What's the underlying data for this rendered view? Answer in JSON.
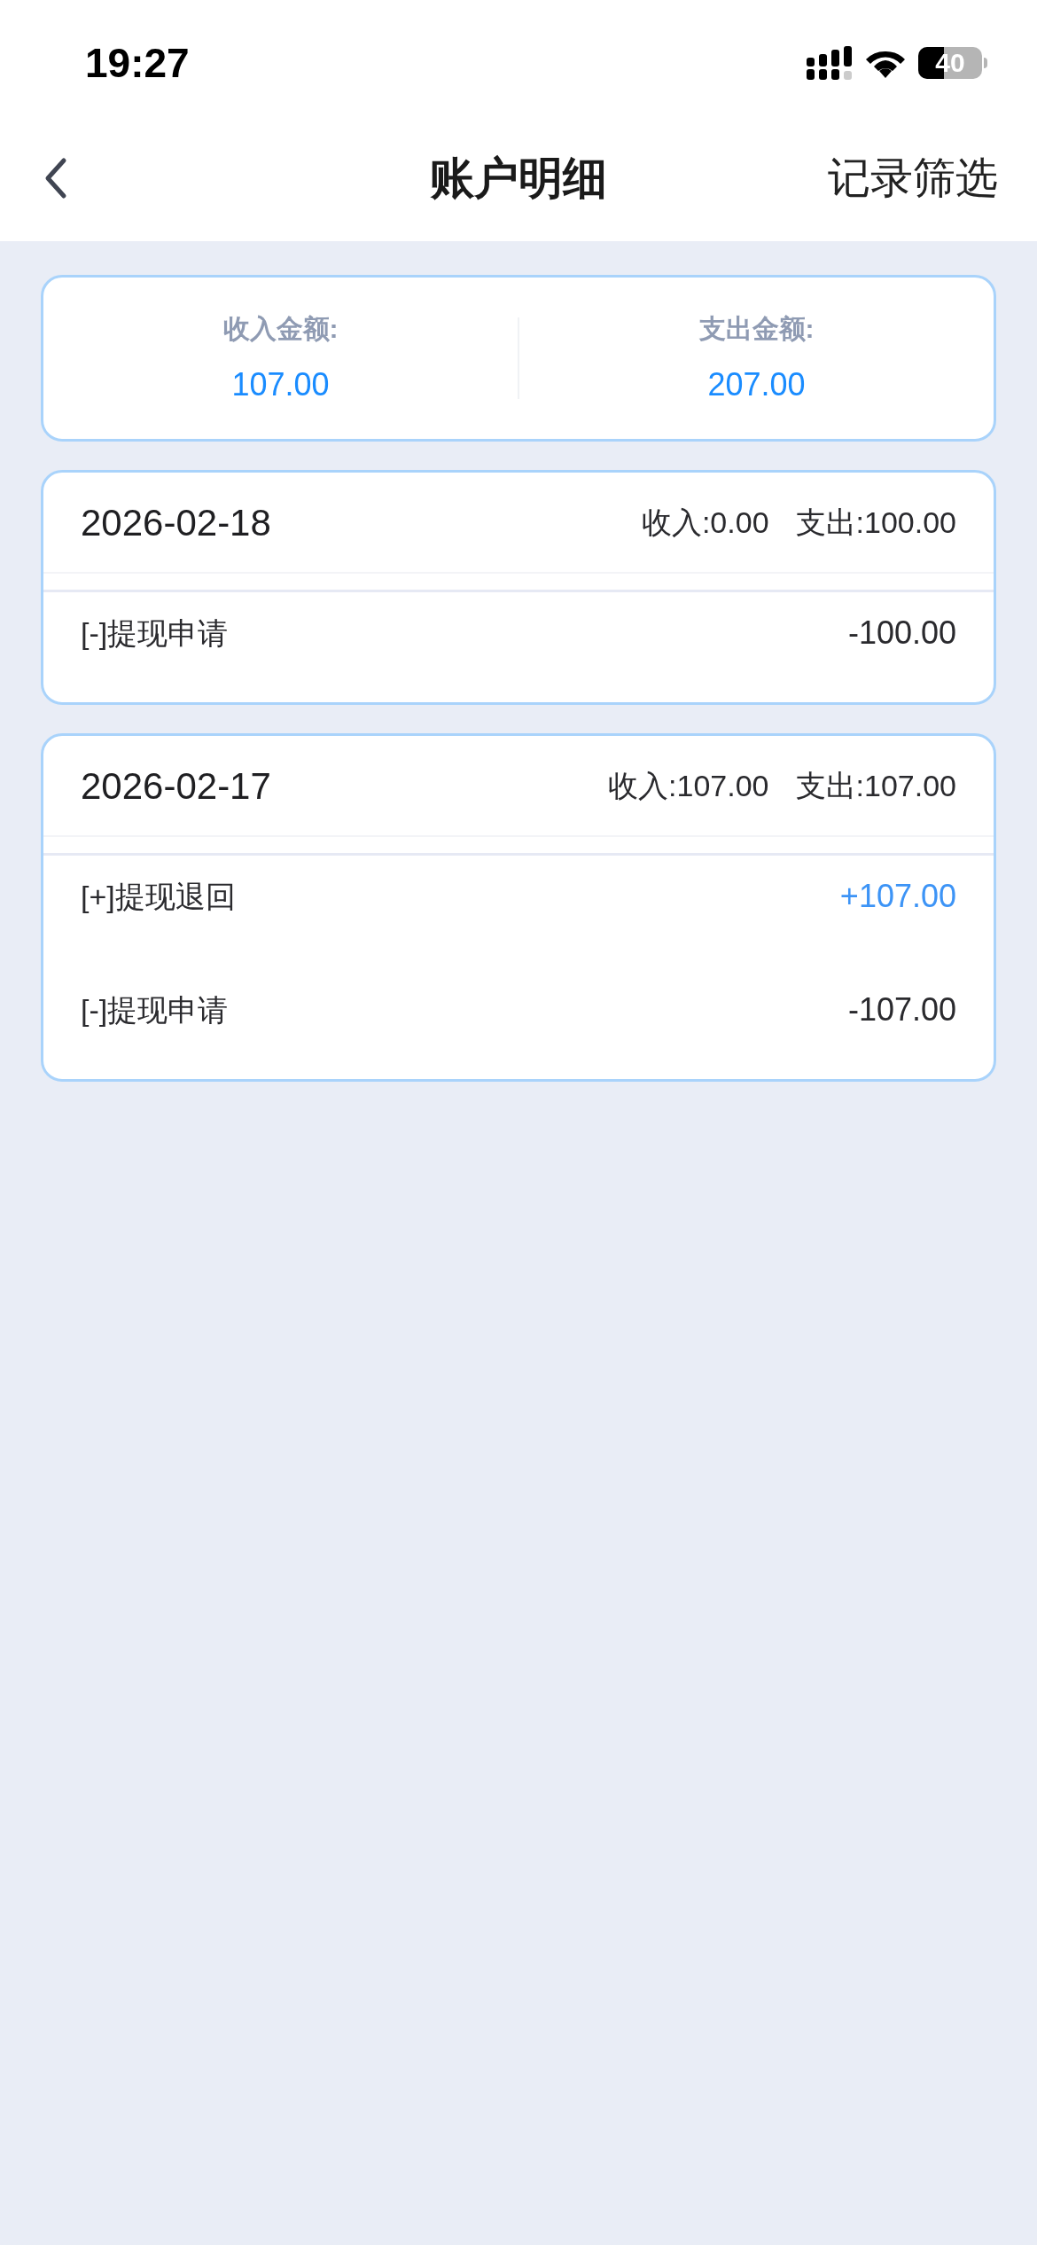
{
  "status_bar": {
    "time": "19:27",
    "battery": "40"
  },
  "nav": {
    "title": "账户明细",
    "action": "记录筛选"
  },
  "summary": [
    {
      "label": "收入金额:",
      "value": "107.00"
    },
    {
      "label": "支出金额:",
      "value": "207.00"
    }
  ],
  "days": [
    {
      "date": "2026-02-18",
      "income": "收入:0.00",
      "expense": "支出:100.00",
      "items": [
        {
          "kind": "expense",
          "name": "[-]提现申请",
          "amount": "-100.00"
        }
      ]
    },
    {
      "date": "2026-02-17",
      "income": "收入:107.00",
      "expense": "支出:107.00",
      "items": [
        {
          "kind": "income",
          "name": "[+]提现退回",
          "amount": "+107.00"
        },
        {
          "kind": "expense",
          "name": "[-]提现申请",
          "amount": "-107.00"
        }
      ]
    }
  ]
}
